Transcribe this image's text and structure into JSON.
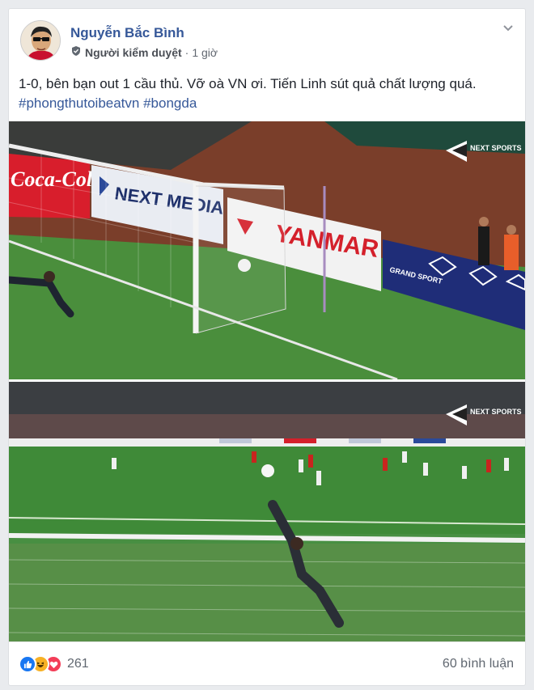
{
  "post": {
    "author": "Nguyễn Bắc Bình",
    "role": "Người kiểm duyệt",
    "separator": "·",
    "time": "1 giờ",
    "text": "1-0, bên bạn out 1 cầu thủ. Vỡ oà VN ơi. Tiến Linh sút quả chất lượng quá.",
    "hashtags": [
      "#phongthutoibeatvn",
      "#bongda"
    ]
  },
  "photo1": {
    "broadcaster_logo": "NEXT SPORTS",
    "boards": {
      "coca_cola": "Coca-Cola",
      "next_media": "NEXT MEDIA",
      "yanmar": "YANMAR",
      "grand_sport": "GRAND SPORT"
    }
  },
  "photo2": {
    "broadcaster_logo": "NEXT SPORTS"
  },
  "footer": {
    "reactions": [
      "like-icon",
      "haha-icon",
      "love-icon"
    ],
    "reaction_count": "261",
    "comments": "60 bình luận"
  },
  "colors": {
    "link": "#365899",
    "like": "#1877f2",
    "haha": "#f7b125",
    "love": "#f33e58",
    "pitch": "#3e8b3a"
  }
}
